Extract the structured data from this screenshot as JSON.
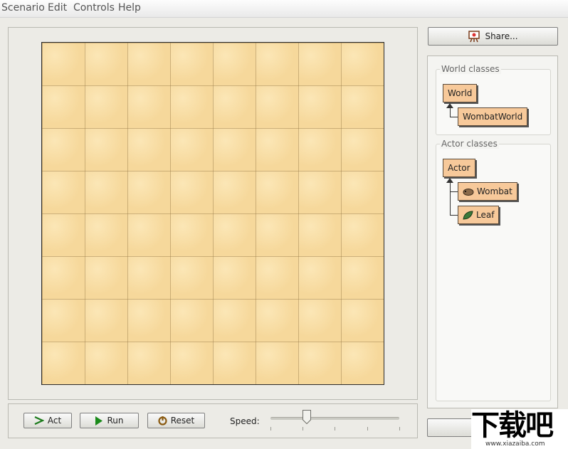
{
  "menu": {
    "items": [
      {
        "label": "Scenario"
      },
      {
        "label": "Edit"
      },
      {
        "label": "Controls"
      },
      {
        "label": "Help"
      }
    ]
  },
  "world": {
    "columns": 8,
    "rows": 8,
    "background_color": "#f6d89b"
  },
  "controls": {
    "act_label": "Act",
    "run_label": "Run",
    "reset_label": "Reset",
    "speed_label": "Speed:",
    "speed_value": 0.28
  },
  "share": {
    "label": "Share..."
  },
  "world_classes": {
    "title": "World classes",
    "root": "World",
    "children": [
      "WombatWorld"
    ]
  },
  "actor_classes": {
    "title": "Actor classes",
    "root": "Actor",
    "children": [
      "Wombat",
      "Leaf"
    ]
  },
  "watermark": {
    "text": "下载吧",
    "url": "www.xiazaiba.com"
  },
  "colors": {
    "class_box": "#f7c99a",
    "accent_green": "#1a8a1a"
  }
}
